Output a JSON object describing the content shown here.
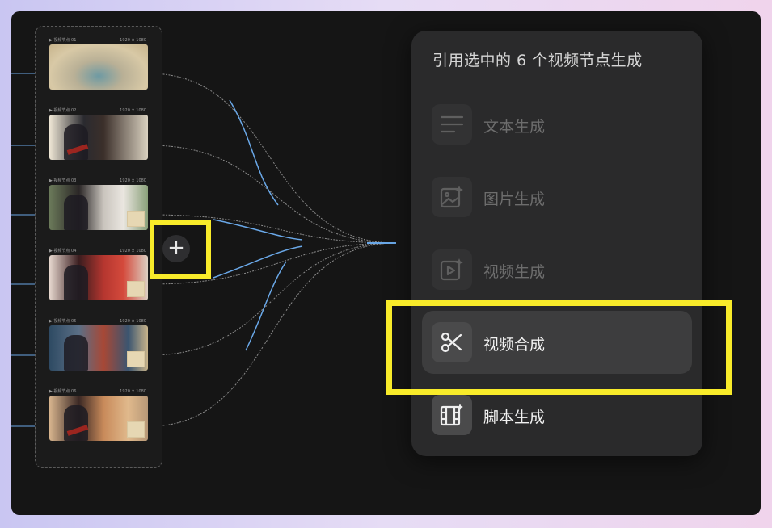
{
  "canvas": {
    "node_group": {
      "nodes": [
        {
          "title": "▶ 视频节点 01",
          "meta": "1920 × 1080"
        },
        {
          "title": "▶ 视频节点 02",
          "meta": "1920 × 1080"
        },
        {
          "title": "▶ 视频节点 03",
          "meta": "1920 × 1080"
        },
        {
          "title": "▶ 视频节点 04",
          "meta": "1920 × 1080"
        },
        {
          "title": "▶ 视频节点 05",
          "meta": "1920 × 1080"
        },
        {
          "title": "▶ 视频节点 06",
          "meta": "1920 × 1080"
        }
      ]
    },
    "add_button": {
      "icon": "plus-icon",
      "glyph": "+"
    },
    "highlight_color": "#f8eb2a",
    "wire_color": "#6aa8e8"
  },
  "menu": {
    "title": "引用选中的 6 个视频节点生成",
    "items": [
      {
        "label": "文本生成",
        "icon": "text-lines-icon",
        "state": "disabled"
      },
      {
        "label": "图片生成",
        "icon": "image-sparkle-icon",
        "state": "disabled"
      },
      {
        "label": "视频生成",
        "icon": "video-sparkle-icon",
        "state": "disabled"
      },
      {
        "label": "视频合成",
        "icon": "scissors-icon",
        "state": "active"
      },
      {
        "label": "脚本生成",
        "icon": "film-script-icon",
        "state": "enabled"
      }
    ]
  }
}
